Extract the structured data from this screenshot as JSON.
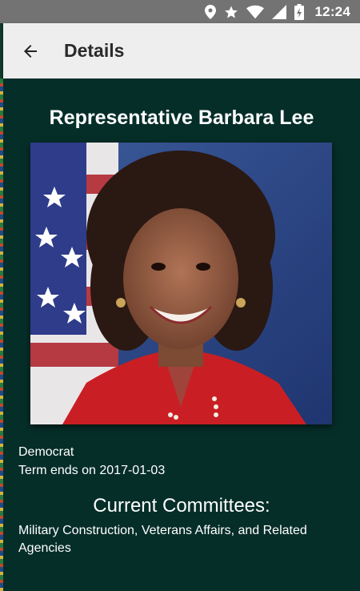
{
  "status_bar": {
    "time": "12:24",
    "icons": [
      "location-icon",
      "star-icon",
      "wifi-icon",
      "signal-icon",
      "battery-icon"
    ]
  },
  "toolbar": {
    "title": "Details",
    "back_icon": "arrow-left-icon"
  },
  "representative": {
    "name": "Representative Barbara Lee",
    "party": "Democrat",
    "term": "Term ends on 2017-01-03"
  },
  "committees": {
    "heading": "Current Committees:",
    "list": "Military Construction, Veterans Affairs, and Related Agencies"
  },
  "colors": {
    "background": "#062e29",
    "toolbar": "#eeeeee",
    "status_bar": "#737373"
  }
}
